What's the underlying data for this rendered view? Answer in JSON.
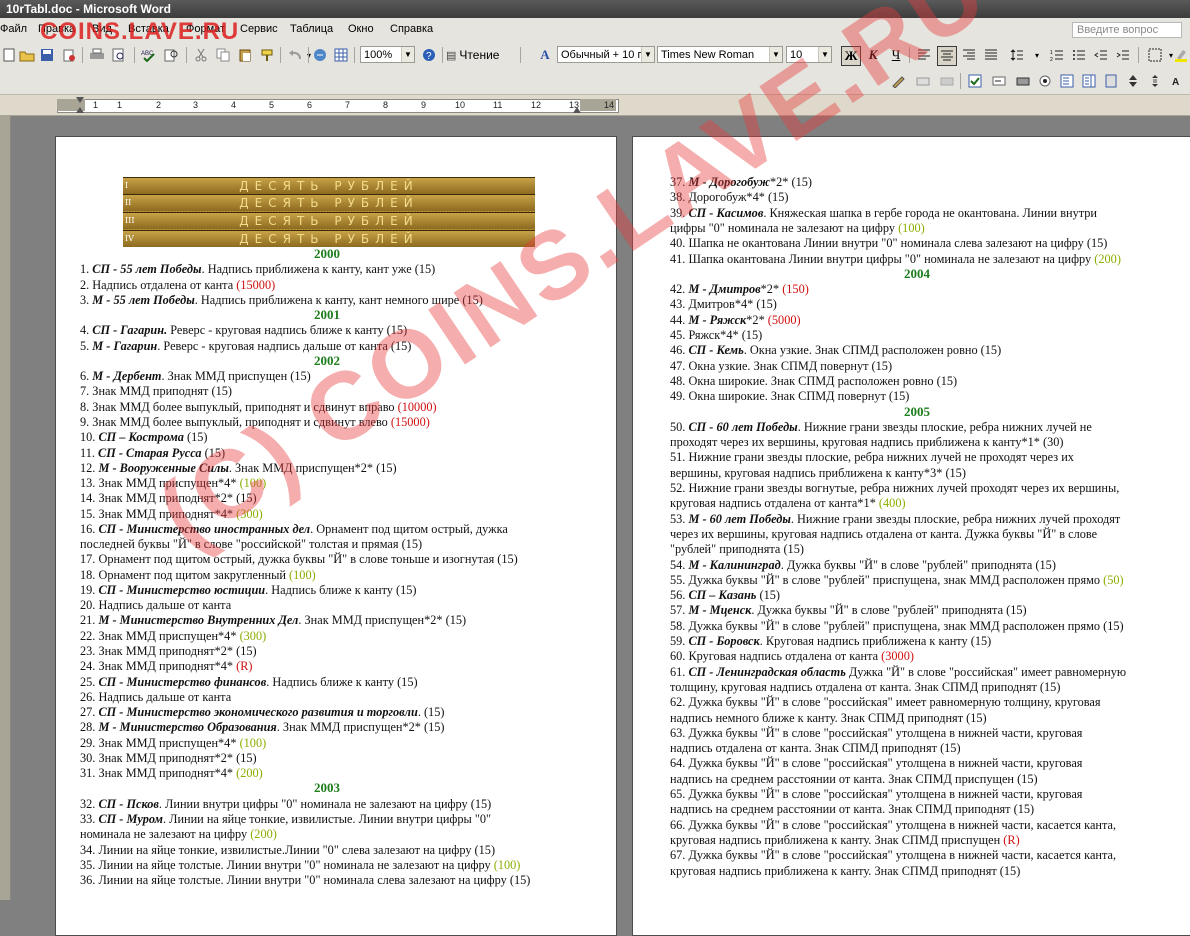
{
  "window": {
    "title": "10rTabl.doc - Microsoft Word"
  },
  "watermark": {
    "top": "COINS.LAVE.RU",
    "diagonal": "(C) COINS.LAVE.RU"
  },
  "menu": {
    "items": [
      "Файл",
      "Правка",
      "Вид",
      "Вставка",
      "Формат",
      "Сервис",
      "Таблица",
      "Окно",
      "Справка"
    ],
    "ask_placeholder": "Введите вопрос"
  },
  "toolbar": {
    "zoom": "100%",
    "reading_label": "Чтение",
    "style": "Обычный + 10 г",
    "font": "Times New Roman",
    "font_size": "10",
    "bold": "Ж",
    "italic": "К",
    "underline": "Ч"
  },
  "ruler": {
    "numbers": [
      "1",
      "1",
      "2",
      "3",
      "4",
      "5",
      "6",
      "7",
      "8",
      "9",
      "10",
      "11",
      "12",
      "13",
      "14"
    ]
  },
  "coin": {
    "inscription": "ДЕСЯТЬ РУБЛЕЙ",
    "rows": [
      "I",
      "II",
      "III",
      "IV"
    ]
  },
  "page1": [
    {
      "type": "year",
      "text": "2000"
    },
    {
      "parts": [
        {
          "t": "1. "
        },
        {
          "t": "СП - 55 лет Победы",
          "b": 1
        },
        {
          "t": ". Надпись приближена к канту, кант уже (15)"
        }
      ]
    },
    {
      "parts": [
        {
          "t": "2. Надпись отдалена от канта "
        },
        {
          "t": "(15000)",
          "c": "red"
        }
      ]
    },
    {
      "parts": [
        {
          "t": "3. "
        },
        {
          "t": "М - 55 лет Победы",
          "b": 1
        },
        {
          "t": ". Надпись приближена к канту, кант немного шире (15)"
        }
      ]
    },
    {
      "type": "year",
      "text": "2001"
    },
    {
      "parts": [
        {
          "t": "4. "
        },
        {
          "t": "СП - Гагарин.",
          "b": 1
        },
        {
          "t": " Реверс - круговая надпись ближе к канту (15)"
        }
      ]
    },
    {
      "parts": [
        {
          "t": "5. "
        },
        {
          "t": "М - Гагарин",
          "b": 1
        },
        {
          "t": ". Реверс - круговая надпись дальше от канта (15)"
        }
      ]
    },
    {
      "type": "year",
      "text": "2002"
    },
    {
      "parts": [
        {
          "t": "6. "
        },
        {
          "t": "М - Дербент",
          "b": 1
        },
        {
          "t": ". Знак ММД приспущен (15)"
        }
      ]
    },
    {
      "parts": [
        {
          "t": "7. Знак ММД приподнят (15)"
        }
      ]
    },
    {
      "parts": [
        {
          "t": "8. Знак ММД более выпуклый, приподнят и сдвинут вправо "
        },
        {
          "t": "(10000)",
          "c": "red"
        }
      ]
    },
    {
      "parts": [
        {
          "t": "9. Знак ММД более выпуклый, приподнят и сдвинут влево "
        },
        {
          "t": "(15000)",
          "c": "red"
        }
      ]
    },
    {
      "parts": [
        {
          "t": "10. "
        },
        {
          "t": "СП – Кострома",
          "b": 1
        },
        {
          "t": " (15)"
        }
      ]
    },
    {
      "parts": [
        {
          "t": "11. "
        },
        {
          "t": "СП - Старая Русса",
          "b": 1
        },
        {
          "t": " (15)"
        }
      ]
    },
    {
      "parts": [
        {
          "t": "12. "
        },
        {
          "t": "М - Вооруженные Силы",
          "b": 1
        },
        {
          "t": ". Знак ММД приспущен*2* (15)"
        }
      ]
    },
    {
      "parts": [
        {
          "t": "13. Знак ММД приспущен*4* "
        },
        {
          "t": "(100)",
          "c": "lime"
        }
      ]
    },
    {
      "parts": [
        {
          "t": "14. Знак ММД приподнят*2* (15)"
        }
      ]
    },
    {
      "parts": [
        {
          "t": "15. Знак ММД приподнят*4* "
        },
        {
          "t": "(300)",
          "c": "lime"
        }
      ]
    },
    {
      "parts": [
        {
          "t": "16. "
        },
        {
          "t": "СП - Министерство иностранных дел",
          "b": 1
        },
        {
          "t": ". Орнамент под щитом острый, дужка"
        }
      ]
    },
    {
      "parts": [
        {
          "t": "последней буквы \"Й\" в слове \"российской\" толстая и прямая (15)"
        }
      ]
    },
    {
      "parts": [
        {
          "t": "17. Орнамент под щитом острый, дужка буквы \"Й\" в слове тоньше и изогнутая (15)"
        }
      ]
    },
    {
      "parts": [
        {
          "t": "18. Орнамент под щитом закругленный "
        },
        {
          "t": "(100)",
          "c": "lime"
        }
      ]
    },
    {
      "parts": [
        {
          "t": "19. "
        },
        {
          "t": "СП - Министерство юстиции",
          "b": 1
        },
        {
          "t": ". Надпись ближе к канту (15)"
        }
      ]
    },
    {
      "parts": [
        {
          "t": "20. Надпись дальше от канта"
        }
      ]
    },
    {
      "parts": [
        {
          "t": "21. "
        },
        {
          "t": "М - Министерство Внутренних Дел",
          "b": 1
        },
        {
          "t": ". Знак ММД приспущен*2* (15)"
        }
      ]
    },
    {
      "parts": [
        {
          "t": "22. Знак ММД приспущен*4* "
        },
        {
          "t": "(300)",
          "c": "lime"
        }
      ]
    },
    {
      "parts": [
        {
          "t": "23. Знак ММД приподнят*2* (15)"
        }
      ]
    },
    {
      "parts": [
        {
          "t": "24. Знак ММД приподнят*4* "
        },
        {
          "t": "(R)",
          "c": "red"
        }
      ]
    },
    {
      "parts": [
        {
          "t": "25. "
        },
        {
          "t": "СП - Министерство финансов",
          "b": 1
        },
        {
          "t": ". Надпись ближе к канту (15)"
        }
      ]
    },
    {
      "parts": [
        {
          "t": "26. Надпись дальше от канта"
        }
      ]
    },
    {
      "parts": [
        {
          "t": "27. "
        },
        {
          "t": "СП - Министерство экономического развития и торговли",
          "b": 1
        },
        {
          "t": ". (15)"
        }
      ]
    },
    {
      "parts": [
        {
          "t": "28. "
        },
        {
          "t": "М - Министерство Образования",
          "b": 1
        },
        {
          "t": ". Знак ММД приспущен*2* (15)"
        }
      ]
    },
    {
      "parts": [
        {
          "t": "29. Знак ММД приспущен*4* "
        },
        {
          "t": "(100)",
          "c": "lime"
        }
      ]
    },
    {
      "parts": [
        {
          "t": "30. Знак ММД приподнят*2* (15)"
        }
      ]
    },
    {
      "parts": [
        {
          "t": "31. Знак ММД приподнят*4* "
        },
        {
          "t": "(200)",
          "c": "lime"
        }
      ]
    },
    {
      "type": "year",
      "text": "2003"
    },
    {
      "parts": [
        {
          "t": "32. "
        },
        {
          "t": "СП - Псков",
          "b": 1
        },
        {
          "t": ". Линии внутри цифры \"0\" номинала не залезают на цифру (15)"
        }
      ]
    },
    {
      "parts": [
        {
          "t": "33. "
        },
        {
          "t": "СП - Муром",
          "b": 1
        },
        {
          "t": ". Линии на яйце тонкие, извилистые. Линии внутри цифры \"0\""
        }
      ]
    },
    {
      "parts": [
        {
          "t": "номинала не залезают на цифру "
        },
        {
          "t": "(200)",
          "c": "lime"
        }
      ]
    },
    {
      "parts": [
        {
          "t": "34. Линии на яйце тонкие, извилистые.Линии \"0\" слева залезают на цифру (15)"
        }
      ]
    },
    {
      "parts": [
        {
          "t": "35. Линии на яйце толстые. Линии внутри \"0\" номинала не залезают на цифру "
        },
        {
          "t": "(100)",
          "c": "lime"
        }
      ]
    },
    {
      "parts": [
        {
          "t": "36. Линии на яйце толстые. Линии внутри \"0\" номинала слева залезают на цифру (15)"
        }
      ]
    }
  ],
  "page2": [
    {
      "parts": [
        {
          "t": "37. "
        },
        {
          "t": "М - Дорогобуж",
          "b": 1
        },
        {
          "t": "*2* (15)"
        }
      ]
    },
    {
      "parts": [
        {
          "t": "38. Дорогобуж*4* (15)"
        }
      ]
    },
    {
      "parts": [
        {
          "t": "39. "
        },
        {
          "t": "СП -  Касимов",
          "b": 1
        },
        {
          "t": ". Княжеская шапка в гербе города не окантована. Линии внутри"
        }
      ]
    },
    {
      "parts": [
        {
          "t": "цифры \"0\" номинала не залезают на цифру "
        },
        {
          "t": "(100)",
          "c": "lime"
        }
      ]
    },
    {
      "parts": [
        {
          "t": "40. Шапка не окантована Линии внутри \"0\" номинала слева залезают на цифру (15)"
        }
      ]
    },
    {
      "parts": [
        {
          "t": "41. Шапка окантована Линии внутри цифры \"0\" номинала не залезают на цифру "
        },
        {
          "t": "(200)",
          "c": "lime"
        }
      ]
    },
    {
      "type": "year",
      "text": "2004"
    },
    {
      "parts": [
        {
          "t": "42. "
        },
        {
          "t": "М - Дмитров",
          "b": 1
        },
        {
          "t": "*2* "
        },
        {
          "t": "(150)",
          "c": "red"
        }
      ]
    },
    {
      "parts": [
        {
          "t": "43. Дмитров*4* (15)"
        }
      ]
    },
    {
      "parts": [
        {
          "t": "44. "
        },
        {
          "t": "М - Ряжск",
          "b": 1
        },
        {
          "t": "*2* "
        },
        {
          "t": "(5000)",
          "c": "red"
        }
      ]
    },
    {
      "parts": [
        {
          "t": "45. Ряжск*4* (15)"
        }
      ]
    },
    {
      "parts": [
        {
          "t": "46. "
        },
        {
          "t": "СП - Кемь",
          "b": 1
        },
        {
          "t": ". Окна узкие. Знак СПМД расположен ровно (15)"
        }
      ]
    },
    {
      "parts": [
        {
          "t": "47. Окна узкие. Знак СПМД повернут (15)"
        }
      ]
    },
    {
      "parts": [
        {
          "t": "48. Окна широкие. Знак СПМД расположен ровно (15)"
        }
      ]
    },
    {
      "parts": [
        {
          "t": "49. Окна широкие. Знак СПМД повернут (15)"
        }
      ]
    },
    {
      "type": "year",
      "text": "2005"
    },
    {
      "parts": [
        {
          "t": "50. "
        },
        {
          "t": "СП - 60 лет Победы",
          "b": 1
        },
        {
          "t": ". Нижние грани звезды плоские, ребра нижних лучей не"
        }
      ]
    },
    {
      "parts": [
        {
          "t": "проходят через их вершины, круговая надпись приближена к канту*1* (30)"
        }
      ]
    },
    {
      "parts": [
        {
          "t": "51. Нижние грани звезды плоские, ребра нижних лучей не проходят через их"
        }
      ]
    },
    {
      "parts": [
        {
          "t": "вершины, круговая надпись приближена к канту*3* (15)"
        }
      ]
    },
    {
      "parts": [
        {
          "t": "52. Нижние грани звезды вогнутые, ребра нижних лучей проходят через их вершины,"
        }
      ]
    },
    {
      "parts": [
        {
          "t": "круговая надпись отдалена от канта*1* "
        },
        {
          "t": "(400)",
          "c": "lime"
        }
      ]
    },
    {
      "parts": [
        {
          "t": "53. "
        },
        {
          "t": "М - 60 лет Победы",
          "b": 1
        },
        {
          "t": ". Нижние грани звезды плоские, ребра нижних лучей проходят"
        }
      ]
    },
    {
      "parts": [
        {
          "t": "через их вершины, круговая надпись отдалена от канта. Дужка буквы \"Й\" в слове"
        }
      ]
    },
    {
      "parts": [
        {
          "t": "\"рублей\" приподнята (15)"
        }
      ]
    },
    {
      "parts": [
        {
          "t": "54. "
        },
        {
          "t": "М -  Калининград",
          "b": 1
        },
        {
          "t": ". Дужка буквы \"Й\" в слове \"рублей\" приподнята (15)"
        }
      ]
    },
    {
      "parts": [
        {
          "t": "55. Дужка буквы \"Й\" в слове \"рублей\" приспущена, знак ММД расположен прямо "
        },
        {
          "t": "(50)",
          "c": "lime"
        }
      ]
    },
    {
      "parts": [
        {
          "t": "56. "
        },
        {
          "t": "СП – Казань",
          "b": 1
        },
        {
          "t": " (15)"
        }
      ]
    },
    {
      "parts": [
        {
          "t": "57. "
        },
        {
          "t": "М - Мценск",
          "b": 1
        },
        {
          "t": ". Дужка буквы \"Й\" в слове \"рублей\" приподнята (15)"
        }
      ]
    },
    {
      "parts": [
        {
          "t": "58. Дужка буквы \"Й\" в слове \"рублей\" приспущена, знак ММД расположен прямо (15)"
        }
      ]
    },
    {
      "parts": [
        {
          "t": "59. "
        },
        {
          "t": "СП - Боровск",
          "b": 1
        },
        {
          "t": ". Круговая надпись приближена к канту (15)"
        }
      ]
    },
    {
      "parts": [
        {
          "t": "60. Круговая надпись отдалена от канта "
        },
        {
          "t": "(3000)",
          "c": "red"
        }
      ]
    },
    {
      "parts": [
        {
          "t": "61. "
        },
        {
          "t": "СП - Ленинградская область",
          "b": 1
        },
        {
          "t": " Дужка \"Й\" в слове \"российская\" имеет равномерную"
        }
      ]
    },
    {
      "parts": [
        {
          "t": "толщину, круговая надпись отдалена от канта. Знак СПМД приподнят (15)"
        }
      ]
    },
    {
      "parts": [
        {
          "t": "62. Дужка буквы \"Й\" в слове \"российская\" имеет равномерную толщину, круговая"
        }
      ]
    },
    {
      "parts": [
        {
          "t": "надпись немного ближе к канту. Знак СПМД приподнят (15)"
        }
      ]
    },
    {
      "parts": [
        {
          "t": "63. Дужка буквы \"Й\" в слове \"российская\" утолщена в нижней части, круговая"
        }
      ]
    },
    {
      "parts": [
        {
          "t": "надпись отдалена от канта. Знак СПМД приподнят (15)"
        }
      ]
    },
    {
      "parts": [
        {
          "t": "64. Дужка буквы \"Й\" в слове \"российская\" утолщена в нижней части, круговая"
        }
      ]
    },
    {
      "parts": [
        {
          "t": "надпись на среднем расстоянии от канта. Знак СПМД приспущен (15)"
        }
      ]
    },
    {
      "parts": [
        {
          "t": "65. Дужка буквы \"Й\" в слове \"российская\" утолщена в нижней части, круговая"
        }
      ]
    },
    {
      "parts": [
        {
          "t": "надпись на среднем расстоянии от канта. Знак СПМД приподнят (15)"
        }
      ]
    },
    {
      "parts": [
        {
          "t": "66. Дужка буквы \"Й\" в слове \"российская\" утолщена в нижней части, касается канта,"
        }
      ]
    },
    {
      "parts": [
        {
          "t": "круговая надпись приближена к канту. Знак СПМД приспущен "
        },
        {
          "t": "(R)",
          "c": "red"
        }
      ]
    },
    {
      "parts": [
        {
          "t": "67. Дужка буквы \"Й\" в слове \"российская\" утолщена в нижней части, касается канта,"
        }
      ]
    },
    {
      "parts": [
        {
          "t": "круговая надпись приближена к канту. Знак СПМД приподнят (15)"
        }
      ]
    }
  ]
}
